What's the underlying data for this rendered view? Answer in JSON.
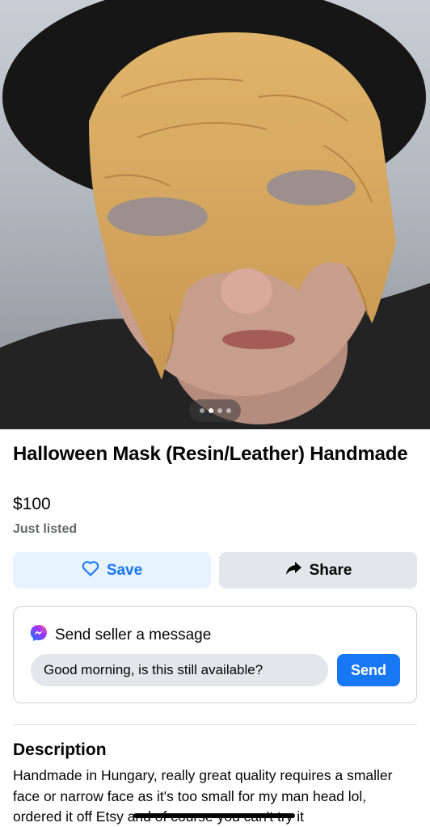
{
  "listing": {
    "title": "Halloween Mask (Resin/Leather) Handmade",
    "price": "$100",
    "status": "Just listed",
    "image_pager": {
      "count": 4,
      "active_index": 1
    }
  },
  "actions": {
    "save_label": "Save",
    "share_label": "Share",
    "save_icon": "heart-outline-icon",
    "share_icon": "share-arrow-icon"
  },
  "message": {
    "heading": "Send seller a message",
    "icon": "messenger-icon",
    "input_value": "Good morning, is this still available?",
    "send_label": "Send"
  },
  "description": {
    "heading": "Description",
    "text": "Handmade in Hungary, really great quality requires a smaller face or narrow face as it's too small for my man head lol, ordered it off Etsy and of course you can't try it"
  },
  "colors": {
    "accent": "#1877f2",
    "save_bg": "#e7f3ff",
    "share_bg": "#e4e6eb",
    "secondary_text": "#65676b"
  }
}
